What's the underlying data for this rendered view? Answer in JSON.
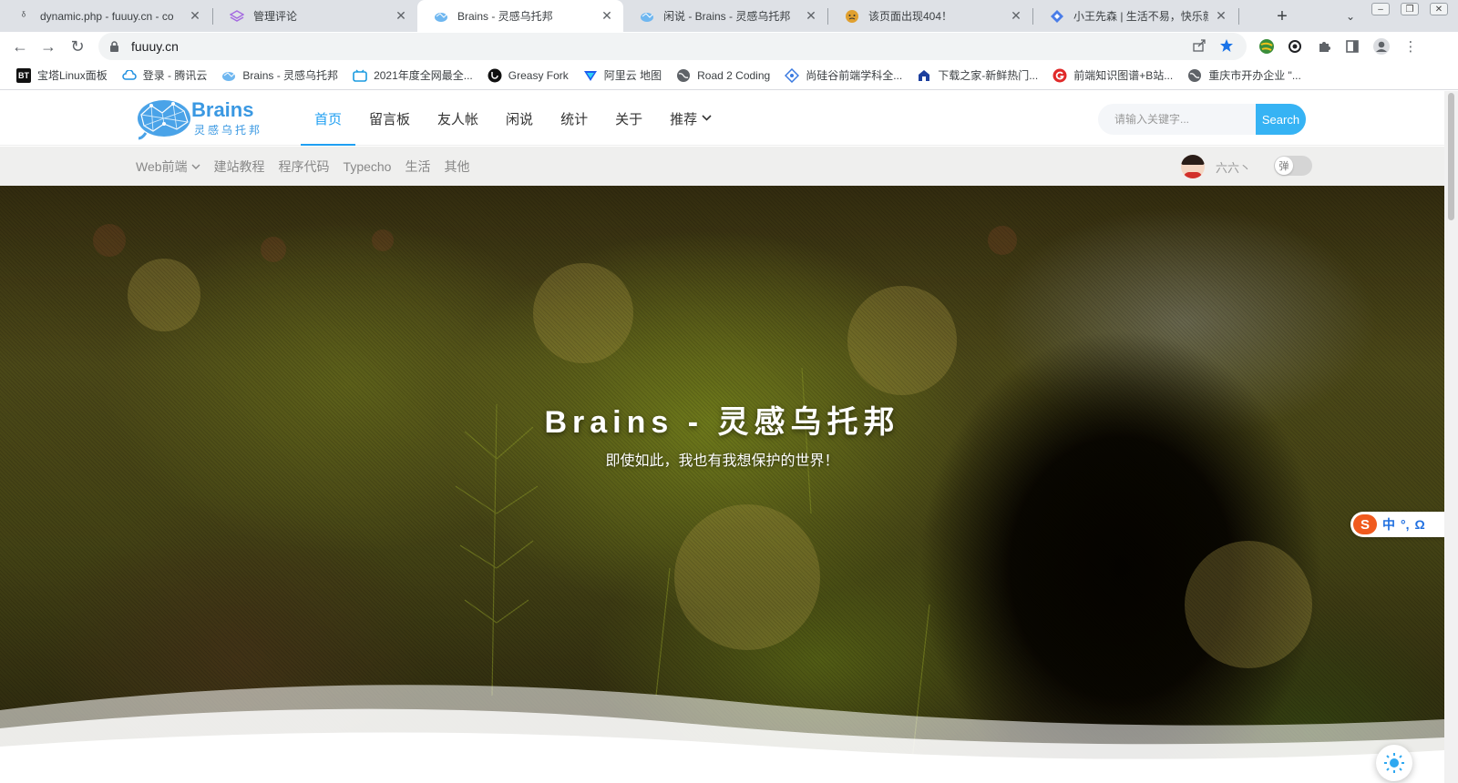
{
  "browser": {
    "tabs": [
      {
        "title": "dynamic.php - fuuuy.cn - co",
        "icon": "bt-panel-icon"
      },
      {
        "title": "管理评论",
        "icon": "layers-icon"
      },
      {
        "title": "Brains - 灵感乌托邦",
        "icon": "brains-icon",
        "active": true
      },
      {
        "title": "闲说 - Brains - 灵感乌托邦",
        "icon": "brains-icon"
      },
      {
        "title": "该页面出现404！",
        "icon": "emoji-icon"
      },
      {
        "title": "小王先森 | 生活不易，快乐就好",
        "icon": "diamond-icon"
      }
    ],
    "url": "fuuuy.cn",
    "bookmarks": [
      {
        "label": "宝塔Linux面板",
        "icon": "bt-icon",
        "icon_text": "BT"
      },
      {
        "label": "登录 - 腾讯云",
        "icon": "cloud-icon"
      },
      {
        "label": "Brains - 灵感乌托邦",
        "icon": "brains-icon"
      },
      {
        "label": "2021年度全网最全...",
        "icon": "bilibili-icon"
      },
      {
        "label": "Greasy Fork",
        "icon": "greasyfork-icon"
      },
      {
        "label": "阿里云 地图",
        "icon": "aliyun-icon"
      },
      {
        "label": "Road 2 Coding",
        "icon": "globe-icon"
      },
      {
        "label": "尚硅谷前端学科全...",
        "icon": "atguigu-icon"
      },
      {
        "label": "下载之家-新鲜热门...",
        "icon": "download-icon"
      },
      {
        "label": "前端知识图谱+B站...",
        "icon": "g-icon"
      },
      {
        "label": "重庆市开办企业 \"...",
        "icon": "globe-icon"
      }
    ]
  },
  "site": {
    "logo_text": "Brains",
    "logo_subtext": "灵感乌托邦",
    "nav": [
      {
        "label": "首页",
        "active": true
      },
      {
        "label": "留言板"
      },
      {
        "label": "友人帐"
      },
      {
        "label": "闲说"
      },
      {
        "label": "统计"
      },
      {
        "label": "关于"
      },
      {
        "label": "推荐",
        "dropdown": true
      }
    ],
    "search": {
      "placeholder": "请输入关键字...",
      "button": "Search"
    },
    "subnav": [
      {
        "label": "Web前端",
        "dropdown": true
      },
      {
        "label": "建站教程"
      },
      {
        "label": "程序代码"
      },
      {
        "label": "Typecho"
      },
      {
        "label": "生活"
      },
      {
        "label": "其他"
      }
    ],
    "user": {
      "name": "六六丶"
    },
    "barrage_toggle": {
      "label": "弹"
    },
    "hero": {
      "title": "Brains - 灵感乌托邦",
      "subtitle": "即使如此，我也有我想保护的世界！"
    },
    "ime": {
      "labels": [
        "中",
        "°,",
        "Ω"
      ]
    }
  },
  "colors": {
    "accent": "#1f9ff2",
    "search_button": "#36b3f4"
  }
}
